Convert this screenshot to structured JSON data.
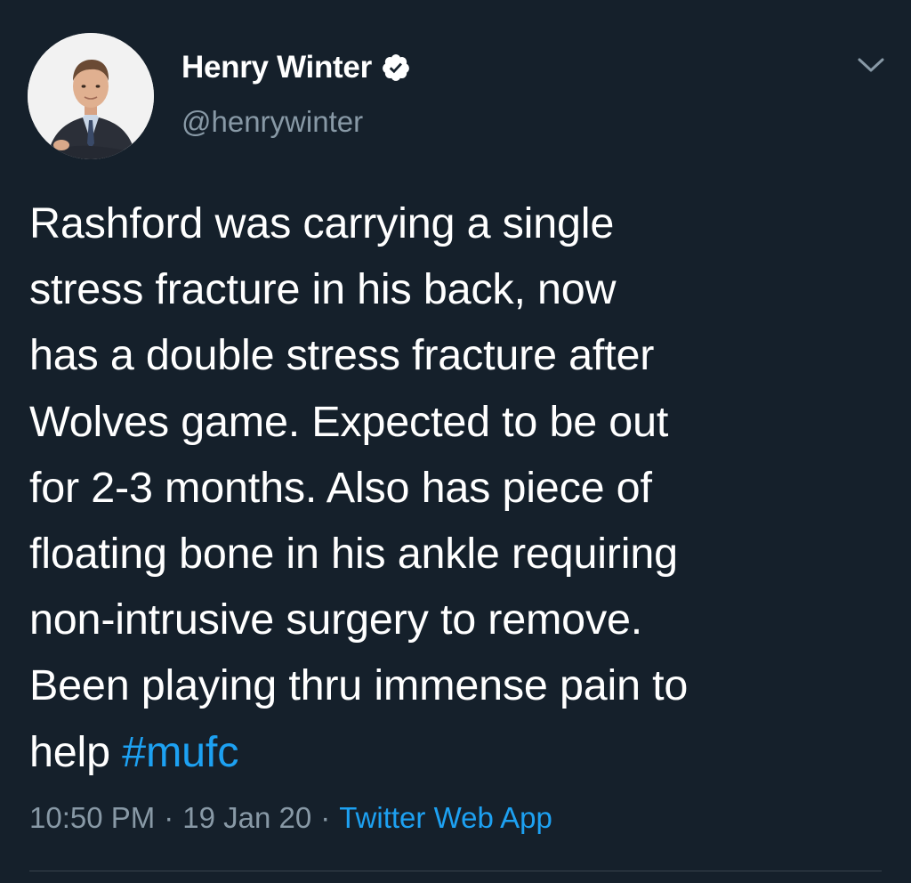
{
  "author": {
    "display_name": "Henry Winter",
    "handle": "@henrywinter",
    "verified": true,
    "avatar_icon": "profile-photo"
  },
  "tweet": {
    "lines": [
      "Rashford was carrying a single",
      "stress fracture in his back, now",
      "has a double stress fracture after",
      "Wolves game. Expected to be out",
      "for 2-3 months. Also has piece of",
      "floating bone in his ankle requiring",
      "non-intrusive surgery to remove.",
      "Been playing thru immense pain to"
    ],
    "last_line_prefix": "help ",
    "hashtag": "#mufc"
  },
  "meta": {
    "time": "10:50 PM",
    "separator": "·",
    "date": "19 Jan 20",
    "source": "Twitter Web App"
  },
  "icons": {
    "verified": "verified-badge-icon",
    "menu": "chevron-down-icon"
  },
  "colors": {
    "background": "#15202b",
    "text": "#ffffff",
    "secondary": "#8899a6",
    "accent": "#1da1f2",
    "divider": "#38444d"
  }
}
